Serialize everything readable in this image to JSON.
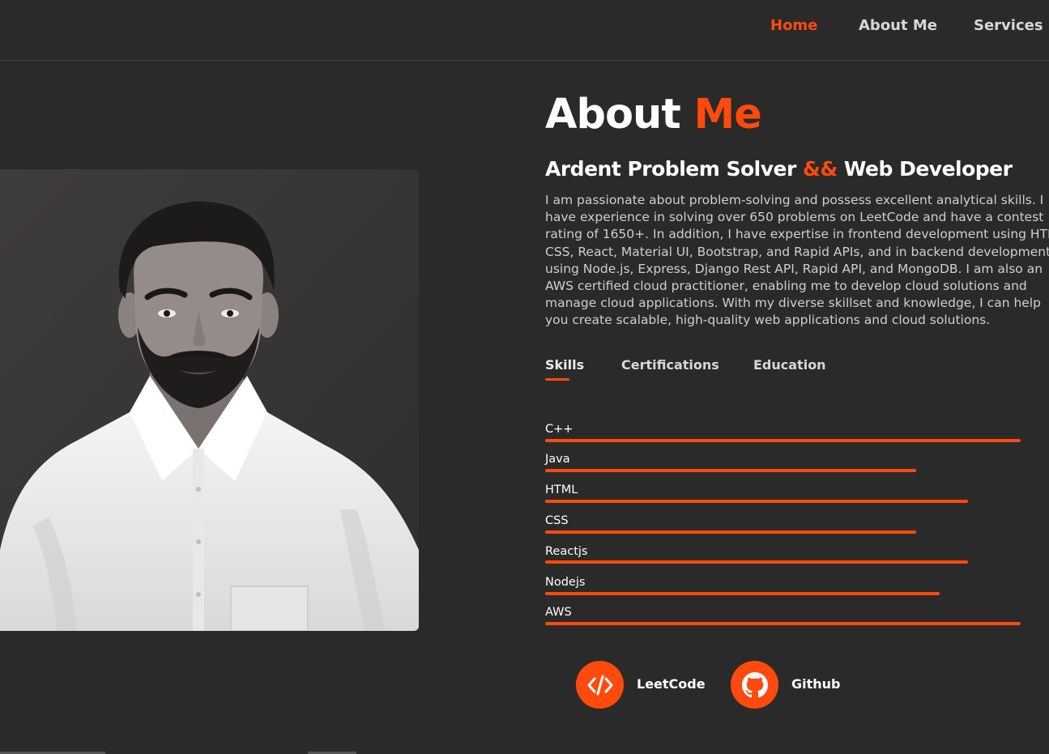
{
  "nav": {
    "home": "Home",
    "about": "About Me",
    "services": "Services"
  },
  "about": {
    "title_main": "About ",
    "title_accent": "Me",
    "subtitle_part1": "Ardent Problem Solver ",
    "subtitle_accent": "&&",
    "subtitle_part2": " Web Developer",
    "description_lines": [
      "I am passionate about problem-solving and possess excellent analytical skills. I",
      "have experience in solving over 650 problems on LeetCode and have a contest",
      "rating of 1650+. In addition, I have expertise in frontend development using HTML,",
      "CSS, React, Material UI, Bootstrap, and Rapid APIs, and in backend development",
      "using Node.js, Express, Django Rest API, Rapid API, and MongoDB. I am also an",
      "AWS certified cloud practitioner, enabling me to develop cloud solutions and",
      "manage cloud applications. With my diverse skillset and knowledge, I can help",
      "you create scalable, high-quality web applications and cloud solutions."
    ]
  },
  "tabs": {
    "skills": "Skills",
    "certifications": "Certifications",
    "education": "Education"
  },
  "skills": [
    {
      "name": "C++",
      "level": 1.0
    },
    {
      "name": "Java",
      "level": 0.78
    },
    {
      "name": "HTML",
      "level": 0.89
    },
    {
      "name": "CSS",
      "level": 0.78
    },
    {
      "name": "Reactjs",
      "level": 0.89
    },
    {
      "name": "Nodejs",
      "level": 0.83
    },
    {
      "name": "AWS",
      "level": 1.0
    }
  ],
  "socials": {
    "leetcode": "LeetCode",
    "github": "Github"
  },
  "colors": {
    "accent": "#ff4a0d",
    "background": "#2a2a2a",
    "text": "#ffffff"
  },
  "icons": {
    "leetcode": "code-icon",
    "github": "github-icon"
  }
}
